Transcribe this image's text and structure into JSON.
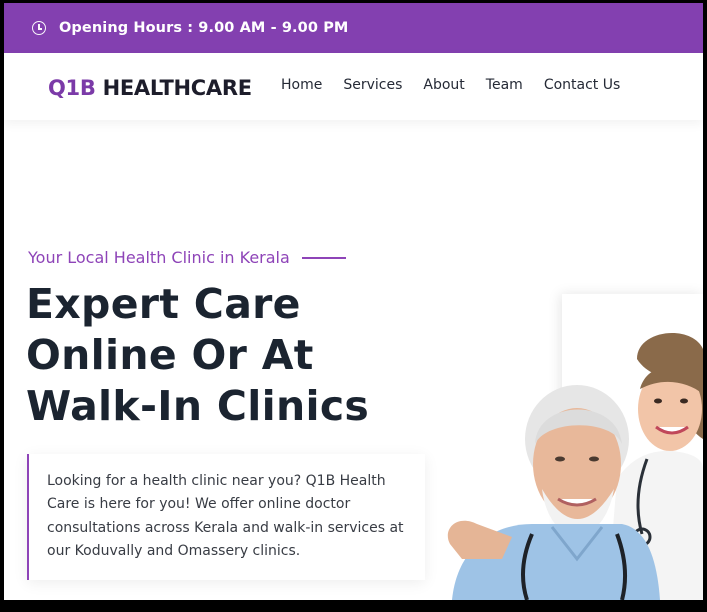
{
  "topbar": {
    "icon": "clock-icon",
    "hours_text": "Opening Hours : 9.00 AM - 9.00 PM",
    "background": "#8340b0"
  },
  "header": {
    "logo_mark": "Q1B",
    "logo_text": "HEALTHCARE",
    "nav": [
      "Home",
      "Services",
      "About",
      "Team",
      "Contact Us"
    ]
  },
  "hero": {
    "tagline": "Your Local Health Clinic in Kerala",
    "headline_lines": [
      "Expert Care",
      "Online Or At",
      "Walk-In Clinics"
    ],
    "description": "Looking for a health clinic near you? Q1B Health Care is here for you! We offer online doctor consultations across Kerala and walk-in services at our Koduvally and Omassery clinics.",
    "accent": "#8e44b8"
  }
}
